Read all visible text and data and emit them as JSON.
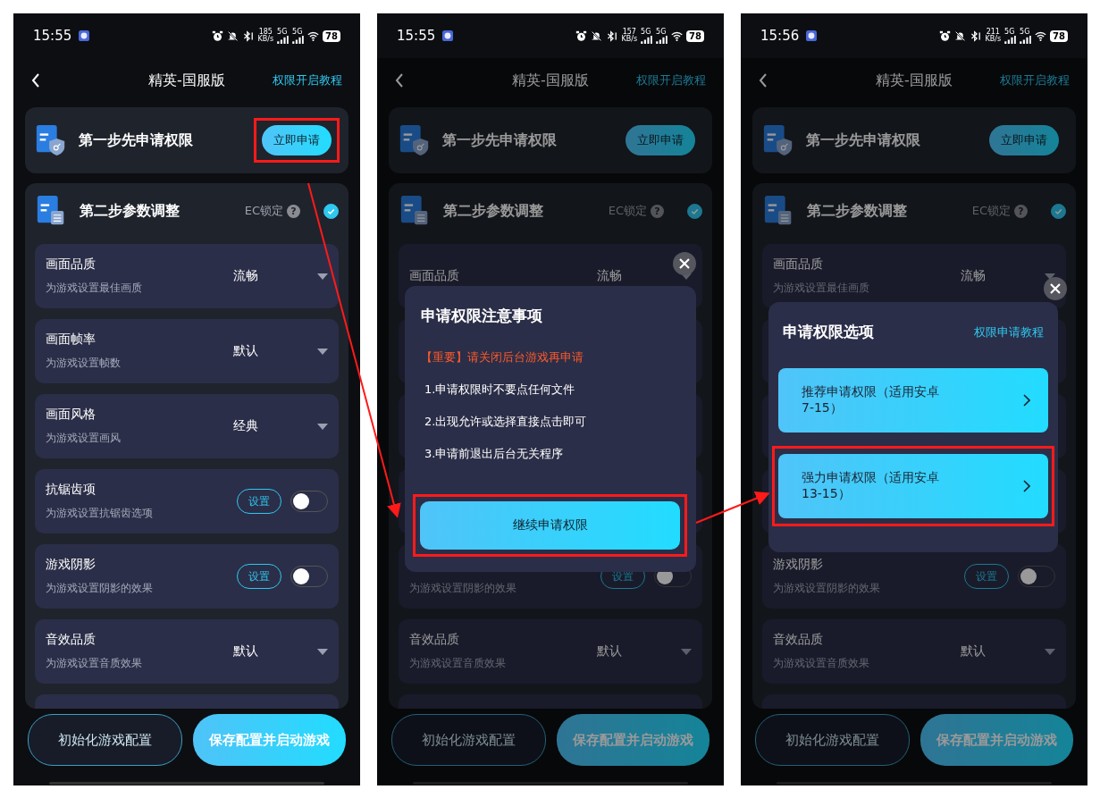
{
  "phones": [
    {
      "status": {
        "time": "15:55",
        "speed": "185",
        "speed_unit": "KB/s",
        "networks": [
          "5G",
          "5G"
        ],
        "battery": "78"
      },
      "header": {
        "title": "精英-国服版",
        "link": "权限开启教程"
      },
      "step1": {
        "title": "第一步先申请权限",
        "button": "立即申请",
        "highlighted": true
      },
      "step2": {
        "title": "第二步参数调整",
        "lock_label": "EC锁定",
        "help": "?",
        "checked": true
      },
      "rows": [
        {
          "kind": "dropdown",
          "title": "画面品质",
          "subtitle": "为游戏设置最佳画质",
          "value": "流畅"
        },
        {
          "kind": "dropdown",
          "title": "画面帧率",
          "subtitle": "为游戏设置帧数",
          "value": "默认"
        },
        {
          "kind": "dropdown",
          "title": "画面风格",
          "subtitle": "为游戏设置画风",
          "value": "经典"
        },
        {
          "kind": "toggle",
          "title": "抗锯齿项",
          "subtitle": "为游戏设置抗锯齿选项",
          "button": "设置",
          "on": false
        },
        {
          "kind": "toggle",
          "title": "游戏阴影",
          "subtitle": "为游戏设置阴影的效果",
          "button": "设置",
          "on": false
        },
        {
          "kind": "dropdown",
          "title": "音效品质",
          "subtitle": "为游戏设置音质效果",
          "value": "默认"
        },
        {
          "kind": "blank"
        }
      ],
      "actions": [
        {
          "label": "初始化游戏配置",
          "primary": false
        },
        {
          "label": "保存配置并启动游戏",
          "primary": true
        }
      ],
      "dimmed": false
    },
    {
      "status": {
        "time": "15:55",
        "speed": "157",
        "speed_unit": "KB/s",
        "networks": [
          "5G",
          "5G"
        ],
        "battery": "78"
      },
      "header": {
        "title": "精英-国服版",
        "link": "权限开启教程"
      },
      "step1": {
        "title": "第一步先申请权限",
        "button": "立即申请"
      },
      "step2": {
        "title": "第二步参数调整",
        "lock_label": "EC锁定",
        "help": "?",
        "checked": true
      },
      "rows": [
        {
          "kind": "dropdown",
          "title": "画面品质",
          "value": "流畅"
        },
        {
          "kind": "blank"
        },
        {
          "kind": "blank"
        },
        {
          "kind": "blank"
        },
        {
          "kind": "toggle",
          "subtitle": "为游戏设置阴影的效果",
          "button": "设置",
          "on": false
        },
        {
          "kind": "dropdown",
          "title": "音效品质",
          "subtitle": "为游戏设置音质效果",
          "value": "默认"
        },
        {
          "kind": "blank"
        }
      ],
      "actions": [
        {
          "label": "初始化游戏配置",
          "primary": false
        },
        {
          "label": "保存配置并启动游戏",
          "primary": true
        }
      ],
      "dimmed": true,
      "dialog": {
        "kind": "notice",
        "title": "申请权限注意事项",
        "warning": "【重要】请关闭后台游戏再申请",
        "items": [
          "1.申请权限时不要点任何文件",
          "2.出现允许或选择直接点击即可",
          "3.申请前退出后台无关程序"
        ],
        "button": "继续申请权限",
        "highlighted": true
      }
    },
    {
      "status": {
        "time": "15:56",
        "speed": "211",
        "speed_unit": "KB/s",
        "networks": [
          "5G",
          "5G"
        ],
        "battery": "78"
      },
      "header": {
        "title": "精英-国服版",
        "link": "权限开启教程"
      },
      "step1": {
        "title": "第一步先申请权限",
        "button": "立即申请"
      },
      "step2": {
        "title": "第二步参数调整",
        "lock_label": "EC锁定",
        "help": "?",
        "checked": true
      },
      "rows": [
        {
          "kind": "dropdown",
          "title": "画面品质",
          "subtitle": "为游戏设置最佳画质",
          "value": "流畅"
        },
        {
          "kind": "blank"
        },
        {
          "kind": "blank"
        },
        {
          "kind": "blank"
        },
        {
          "kind": "toggle",
          "title": "游戏阴影",
          "subtitle": "为游戏设置阴影的效果",
          "button": "设置",
          "on": false
        },
        {
          "kind": "dropdown",
          "title": "音效品质",
          "subtitle": "为游戏设置音质效果",
          "value": "默认"
        },
        {
          "kind": "blank"
        }
      ],
      "actions": [
        {
          "label": "初始化游戏配置",
          "primary": false
        },
        {
          "label": "保存配置并启动游戏",
          "primary": true
        }
      ],
      "dimmed": true,
      "dialog": {
        "kind": "options",
        "title": "申请权限选项",
        "link": "权限申请教程",
        "options": [
          {
            "label": "推荐申请权限（适用安卓7-15）"
          },
          {
            "label": "强力申请权限（适用安卓13-15）",
            "highlighted": true
          }
        ]
      }
    }
  ]
}
